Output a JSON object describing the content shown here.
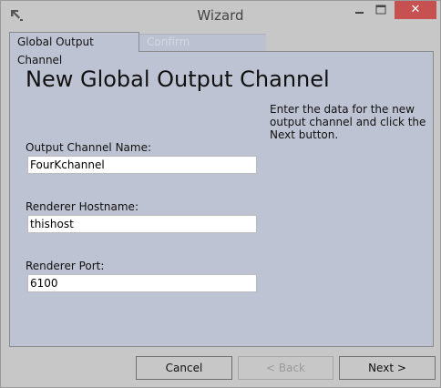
{
  "window": {
    "title": "Wizard",
    "close_glyph": "✕"
  },
  "tabs": [
    {
      "label": "Global Output Channel",
      "active": true
    },
    {
      "label": "Confirm",
      "active": false
    }
  ],
  "page": {
    "title": "New Global Output Channel",
    "help_text": "Enter the data for the new output channel and click the Next button."
  },
  "fields": {
    "channel_name": {
      "label": "Output Channel Name:",
      "value": "FourKchannel"
    },
    "renderer_hostname": {
      "label": "Renderer Hostname:",
      "value": "thishost"
    },
    "renderer_port": {
      "label": "Renderer Port:",
      "value": "6100"
    }
  },
  "buttons": {
    "cancel": "Cancel",
    "back": "< Back",
    "next": "Next >"
  },
  "colors": {
    "panel_background": "#bec3d3",
    "close_button": "#c75050",
    "window_chrome": "#c7c7c7"
  }
}
